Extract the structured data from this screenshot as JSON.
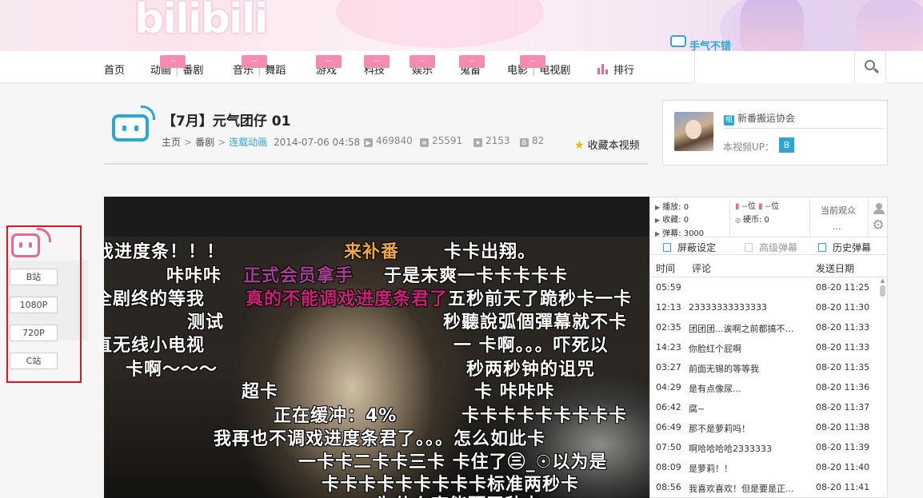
{
  "banner": {
    "logo_text": "bilibili",
    "tag_text": "手气不错"
  },
  "nav": {
    "items": [
      {
        "label": "首页"
      },
      {
        "label": "动画",
        "label2": "番剧",
        "badge": "--"
      },
      {
        "label": "音乐",
        "label2": "舞蹈",
        "badge": "--"
      },
      {
        "label": "游戏",
        "badge": "--"
      },
      {
        "label": "科技",
        "badge": "--"
      },
      {
        "label": "娱乐",
        "badge": "--"
      },
      {
        "label": "鬼畜",
        "badge": "--"
      },
      {
        "label": "电影",
        "label2": "电视剧",
        "badge": "--"
      },
      {
        "label": "排行"
      }
    ],
    "separator": "|"
  },
  "video": {
    "title": "【7月】元气团仔 01",
    "breadcrumb": [
      "主页",
      "番剧",
      "连载动画"
    ],
    "breadcrumb_sep": ">",
    "date": "2014-07-06 04:58",
    "plays": "469840",
    "danmaku": "25591",
    "favorites": "2153",
    "coins": "82",
    "fav_label": "收藏本视频"
  },
  "uploader": {
    "group_tag": "组",
    "group_name": "新番搬运协会",
    "up_label": "本视频UP：",
    "up_badge": "B"
  },
  "quality": {
    "options": [
      "B站",
      "1080P",
      "720P",
      "C站"
    ]
  },
  "player": {
    "danmaku": [
      {
        "text": "戏进度条！！！",
        "color": "white"
      },
      {
        "text": "来补番",
        "color": "orange"
      },
      {
        "text": "卡卡出翔。",
        "color": "white"
      },
      {
        "text": "咔咔咔",
        "color": "white"
      },
      {
        "text": "正式会员拿手",
        "color": "purple"
      },
      {
        "text": "于是末爽一卡卡卡卡卡",
        "color": "white"
      },
      {
        "text": "全剧终的等我",
        "color": "white"
      },
      {
        "text": "真的不能调戏进度条君了",
        "color": "magenta"
      },
      {
        "text": "五秒前天了跪秒卡一卡",
        "color": "white"
      },
      {
        "text": "测试",
        "color": "white"
      },
      {
        "text": "秒聽說弧個彈幕就不卡",
        "color": "white"
      },
      {
        "text": "直无线小电视",
        "color": "white"
      },
      {
        "text": "一 卡啊。。。吓死以",
        "color": "white"
      },
      {
        "text": "卡啊～～～",
        "color": "white"
      },
      {
        "text": "秒两秒钟的诅咒",
        "color": "white"
      },
      {
        "text": "超卡",
        "color": "white"
      },
      {
        "text": "卡 咔咔咔",
        "color": "white"
      },
      {
        "text": "正在缓冲：4%",
        "color": "white"
      },
      {
        "text": "卡卡卡卡卡卡卡卡卡",
        "color": "white"
      },
      {
        "text": "我再也不调戏进度条君了。。。怎么如此卡",
        "color": "white"
      },
      {
        "text": "一卡卡二卡卡三卡 卡住了㊂_☉以为是",
        "color": "white"
      },
      {
        "text": "卡卡卡卡卡卡卡卡卡标准两秒卡",
        "color": "white"
      },
      {
        "text": "为什么高能预王秒卡",
        "color": "white"
      }
    ]
  },
  "danmaku_panel": {
    "stats": {
      "play": "播放: 0",
      "rank": "--位",
      "rank2": "--位",
      "fav": "收藏: 0",
      "coin": "硬币: 0",
      "dm": "弹幕: 3000"
    },
    "viewer_label": "当前观众",
    "viewer_value": "...",
    "tabs": [
      "屏蔽设定",
      "高级弹幕",
      "历史弹幕"
    ],
    "columns": [
      "时间",
      "评论",
      "发送日期"
    ],
    "rows": [
      {
        "time": "05:59",
        "comment": "",
        "date": "08-20 11:25"
      },
      {
        "time": "12:13",
        "comment": "23333333333333",
        "date": "08-20 11:30"
      },
      {
        "time": "02:35",
        "comment": "团团团...诶啊之前都搞不懂...",
        "date": "08-20 11:33"
      },
      {
        "time": "14:23",
        "comment": "你脸红个屁啊",
        "date": "08-20 11:33"
      },
      {
        "time": "03:27",
        "comment": "前面无锡的等等我",
        "date": "08-20 11:35"
      },
      {
        "time": "04:29",
        "comment": "是有点像尿...",
        "date": "08-20 11:36"
      },
      {
        "time": "06:42",
        "comment": "腐~",
        "date": "08-20 11:37"
      },
      {
        "time": "06:49",
        "comment": "那不是萝莉吗！",
        "date": "08-20 11:38"
      },
      {
        "time": "07:50",
        "comment": "啊哈哈哈哈2333333",
        "date": "08-20 11:39"
      },
      {
        "time": "08:09",
        "comment": "是萝莉！！",
        "date": "08-20 11:40"
      },
      {
        "time": "08:56",
        "comment": "我喜欢喜欢！但是要是正...",
        "date": "08-20 11:41"
      }
    ]
  },
  "colors": {
    "accent_blue": "#2aa7d9",
    "accent_pink": "#e56b94",
    "highlight_red": "#e0161b"
  }
}
